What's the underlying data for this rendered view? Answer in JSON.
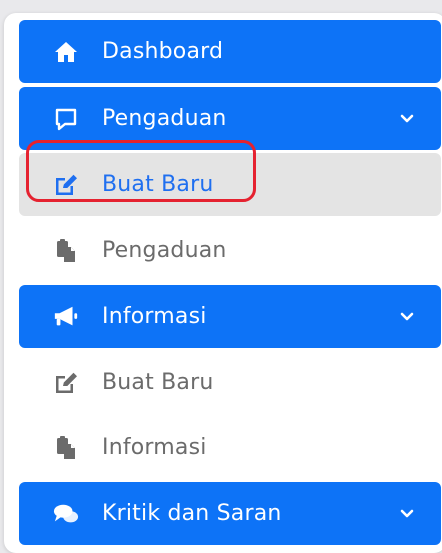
{
  "colors": {
    "primary": "#0d73f7",
    "active_bg": "#e4e4e4",
    "active_text": "#1f6ff0",
    "sub_text": "#6b6b6b",
    "highlight_border": "#e52230"
  },
  "menu": {
    "dashboard": {
      "label": "Dashboard",
      "icon": "home-icon"
    },
    "pengaduan": {
      "label": "Pengaduan",
      "icon": "comment-icon",
      "expanded_icon": "chevron-down-icon"
    },
    "pengaduan_buat_baru": {
      "label": "Buat Baru",
      "icon": "edit-icon",
      "active": true
    },
    "pengaduan_list": {
      "label": "Pengaduan",
      "icon": "clipboard-icon"
    },
    "informasi": {
      "label": "Informasi",
      "icon": "megaphone-icon",
      "expanded_icon": "chevron-down-icon"
    },
    "informasi_buat_baru": {
      "label": "Buat Baru",
      "icon": "edit-icon"
    },
    "informasi_list": {
      "label": "Informasi",
      "icon": "clipboard-icon"
    },
    "kritik": {
      "label": "Kritik dan Saran",
      "icon": "comments-icon",
      "expanded_icon": "chevron-down-icon"
    }
  }
}
